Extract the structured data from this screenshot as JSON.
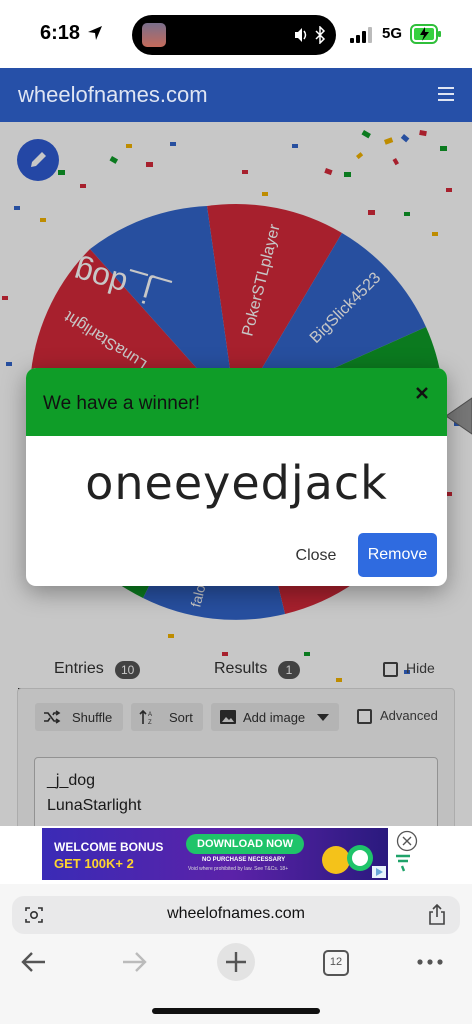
{
  "status_bar": {
    "time": "6:18",
    "network": "5G"
  },
  "header": {
    "title": "wheelofnames.com"
  },
  "wheel": {
    "segments": [
      {
        "label": "_j_dog",
        "color": "#3366cc"
      },
      {
        "label": "PokerSTLplayer",
        "color": "#d62a3a"
      },
      {
        "label": "BigSlick4523",
        "color": "#3366cc"
      },
      {
        "label": "LunaStarlight",
        "color": "#d62a3a"
      },
      {
        "label": "falo",
        "color": "#3366cc"
      }
    ]
  },
  "modal": {
    "title": "We have a winner!",
    "winner": "oneeyedjack",
    "close_label": "Close",
    "remove_label": "Remove"
  },
  "tabs": {
    "entries_label": "Entries",
    "entries_count": "10",
    "results_label": "Results",
    "results_count": "1",
    "hide_label": "Hide"
  },
  "toolbar": {
    "shuffle_label": "Shuffle",
    "sort_label": "Sort",
    "add_image_label": "Add image",
    "advanced_label": "Advanced"
  },
  "entries": [
    "_j_dog",
    "LunaStarlight"
  ],
  "ad": {
    "line1": "WELCOME BONUS",
    "line2": "GET 100K+ 2",
    "cta": "DOWNLOAD NOW",
    "small1": "NO PURCHASE NECESSARY",
    "small2": "Void where prohibited by law. See T&Cs. 18+"
  },
  "browser": {
    "url": "wheelofnames.com",
    "tab_count": "12"
  }
}
